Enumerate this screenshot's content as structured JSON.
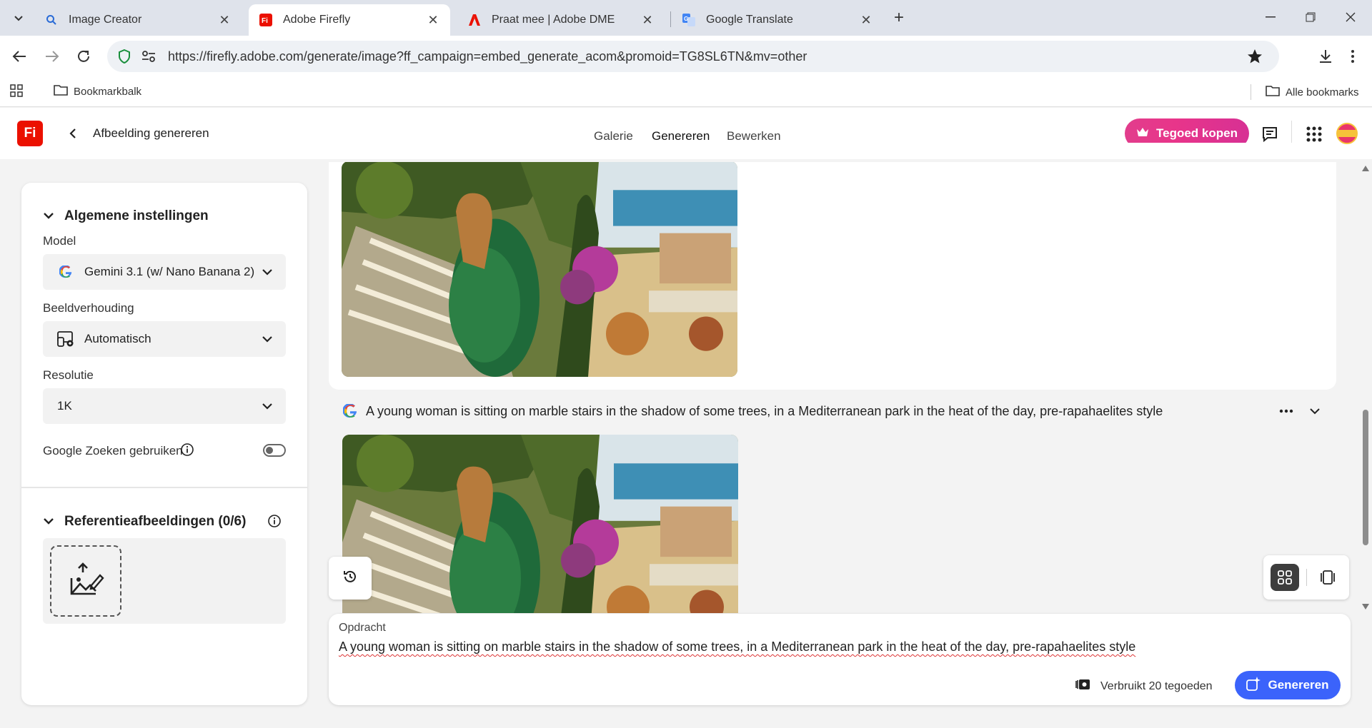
{
  "browser": {
    "tabs": [
      {
        "label": "Image Creator",
        "icon": "search-icon"
      },
      {
        "label": "Adobe Firefly",
        "icon": "firefly-icon"
      },
      {
        "label": "Praat mee | Adobe DME",
        "icon": "adobe-icon"
      },
      {
        "label": "Google Translate",
        "icon": "translate-icon"
      }
    ],
    "url": "https://firefly.adobe.com/generate/image?ff_campaign=embed_generate_acom&promoid=TG8SL6TN&mv=other",
    "bookmarks_folder": "Bookmarkbalk",
    "all_bookmarks": "Alle bookmarks"
  },
  "app": {
    "logo": "Fi",
    "page_title": "Afbeelding genereren",
    "nav": [
      "Galerie",
      "Genereren",
      "Bewerken"
    ],
    "active_nav": "Genereren",
    "buy_label": "Tegoed kopen",
    "colors": {
      "accent": "#3b63fb",
      "buy": "#e8358a",
      "brand": "#eb1000"
    }
  },
  "settings": {
    "general_title": "Algemene instellingen",
    "model_label": "Model",
    "model_value": "Gemini 3.1 (w/ Nano Banana 2)",
    "aspect_label": "Beeldverhouding",
    "aspect_value": "Automatisch",
    "resolution_label": "Resolutie",
    "resolution_value": "1K",
    "google_search_label": "Google Zoeken gebruiken",
    "google_search_enabled": false,
    "reference_title": "Referentieafbeeldingen (0/6)"
  },
  "results": {
    "prompt": "A young woman is sitting on marble stairs in the shadow of some trees, in a Mediterranean park in the heat of the day, pre-rapahaelites style"
  },
  "composer": {
    "label": "Opdracht",
    "text": "A young woman is sitting on marble stairs in the shadow of some trees, in a Mediterranean park in the heat of the day, pre-rapahaelites style",
    "credits": "Verbruikt 20 tegoeden",
    "generate_label": "Genereren"
  }
}
